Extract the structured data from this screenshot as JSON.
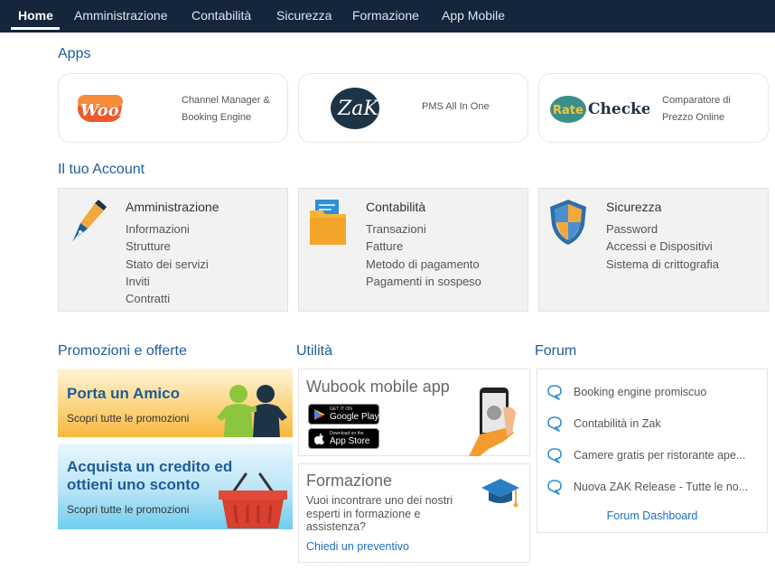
{
  "nav": {
    "items": [
      {
        "label": "Home",
        "active": true
      },
      {
        "label": "Amministrazione"
      },
      {
        "label": "Contabilità"
      },
      {
        "label": "Sicurezza"
      },
      {
        "label": "Formazione"
      },
      {
        "label": "App Mobile"
      }
    ]
  },
  "apps": {
    "title": "Apps",
    "cards": [
      {
        "logo": "WooDoo",
        "logo_icon": "woodoo-logo",
        "desc_lines": [
          "Channel Manager &",
          "Booking Engine"
        ]
      },
      {
        "logo": "ZaK",
        "logo_icon": "zak-logo",
        "desc_lines": [
          "PMS All In One"
        ]
      },
      {
        "logo_parts": [
          "Rate",
          "Checker"
        ],
        "logo_icon": "ratechecker-logo",
        "desc_lines": [
          "Comparatore di",
          "Prezzo Online"
        ]
      }
    ]
  },
  "account": {
    "title": "Il tuo Account",
    "cards": [
      {
        "title": "Amministrazione",
        "icon": "fountain-pen-icon",
        "links": [
          "Informazioni",
          "Strutture",
          "Stato dei servizi",
          "Inviti",
          "Contratti"
        ]
      },
      {
        "title": "Contabilità",
        "icon": "folder-icon",
        "links": [
          "Transazioni",
          "Fatture",
          "Metodo di pagamento",
          "Pagamenti in sospeso"
        ]
      },
      {
        "title": "Sicurezza",
        "icon": "shield-icon",
        "links": [
          "Password",
          "Accessi e Dispositivi",
          "Sistema di crittografia"
        ]
      }
    ]
  },
  "promotions": {
    "title": "Promozioni e offerte",
    "cards": [
      {
        "title": "Porta un Amico",
        "subtitle": "Scopri tutte le promozioni",
        "icon": "friends-icon"
      },
      {
        "title": "Acquista un credito ed ottieni uno sconto",
        "subtitle": "Scopri tutte le promozioni",
        "icon": "basket-icon"
      }
    ]
  },
  "utility": {
    "title": "Utilità",
    "mobile": {
      "title": "Wubook mobile app",
      "google_play": {
        "small": "GET IT ON",
        "big": "Google Play"
      },
      "app_store": {
        "small": "Download on the",
        "big": "App Store"
      },
      "icon": "phone-in-hand-icon"
    },
    "training": {
      "title": "Formazione",
      "text": "Vuoi incontrare uno dei nostri esperti in formazione e assistenza?",
      "link": "Chiedi un preventivo",
      "icon": "graduation-cap-icon"
    }
  },
  "forum": {
    "title": "Forum",
    "items": [
      "Booking engine promiscuo",
      "Contabilità in Zak",
      "Camere gratis per ristorante ape...",
      "Nuova ZAK Release - Tutte le no..."
    ],
    "dashboard_link": "Forum Dashboard"
  },
  "colors": {
    "nav_bg": "#14253c",
    "section_title": "#1f5c99",
    "link": "#1f6fbf"
  }
}
